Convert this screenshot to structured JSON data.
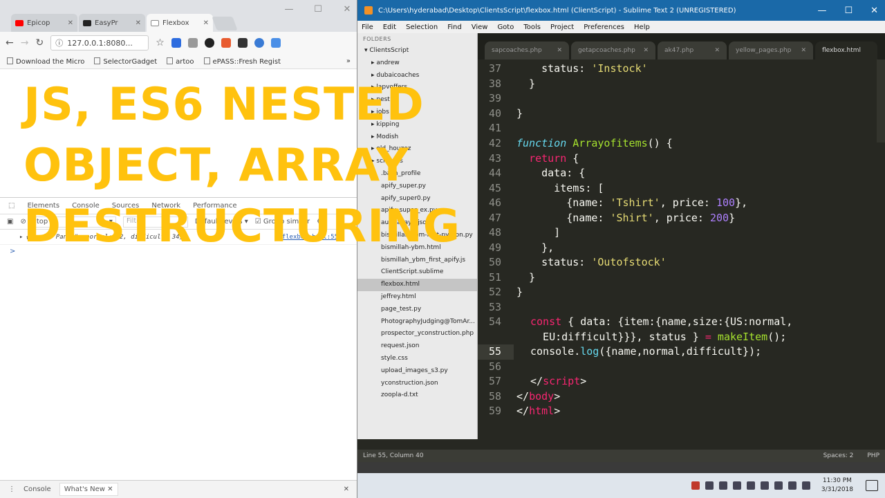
{
  "browser": {
    "tabs": [
      {
        "label": "Epicop",
        "color": "#ff0000"
      },
      {
        "label": "EasyPr",
        "color": "#222222"
      },
      {
        "label": "Flexbox",
        "color": "#888888"
      }
    ],
    "address": "127.0.0.1:8080...",
    "bookmarks": [
      "Download the Micro",
      "SelectorGadget",
      "artoo",
      "ePASS::Fresh Regist"
    ],
    "devtools": {
      "tabs": [
        "Elements",
        "Console",
        "Sources",
        "Network",
        "Performance"
      ],
      "context": "top",
      "filter_placeholder": "Filter",
      "levels": "Default levels",
      "group_similar": "Group similar",
      "log_text": "{name: \"Pants\", normal: 32, difficult: 34}",
      "log_source": "flexbox.html:55",
      "prompt": ">",
      "drawer_tabs": [
        "Console",
        "What's New"
      ]
    }
  },
  "sublime": {
    "title": "C:\\Users\\hyderabad\\Desktop\\ClientsScript\\flexbox.html (ClientScript) - Sublime Text 2 (UNREGISTERED)",
    "menu": [
      "File",
      "Edit",
      "Selection",
      "Find",
      "View",
      "Goto",
      "Tools",
      "Project",
      "Preferences",
      "Help"
    ],
    "sidebar_header": "FOLDERS",
    "files": [
      "▾ ClientsScript",
      "▸ andrew",
      "▸ dubaicoaches",
      "▸ lapvoffers",
      "▸ nest",
      "▸ jobs",
      "▸ kipping",
      "▸ Modish",
      "▸ old_houzez",
      "▸ scrapers",
      ".bash_profile",
      "apify_super.py",
      "apify_super0.py",
      "apify_super_ex.py",
      "australiayp.json",
      "bismillah-ybm-first-python.py",
      "bismillah-ybm.html",
      "bismillah_ybm_first_apify.js",
      "ClientScript.sublime",
      "flexbox.html",
      "jeffrey.html",
      "page_test.py",
      "PhotographyJudging@TomAr...",
      "prospector_yconstruction.php",
      "request.json",
      "style.css",
      "upload_images_s3.py",
      "yconstruction.json",
      "zoopla-d.txt"
    ],
    "tabs": [
      "sapcoaches.php",
      "getapcoaches.php",
      "ak47.php",
      "yellow_pages.php",
      "flexbox.html"
    ],
    "status": "Line 55, Column 40",
    "spaces": "Spaces: 2",
    "syntax": "PHP"
  },
  "code": {
    "lines": [
      "37",
      "38",
      "39",
      "40",
      "41",
      "42",
      "43",
      "44",
      "45",
      "46",
      "47",
      "48",
      "49",
      "50",
      "51",
      "52",
      "53",
      "54",
      "",
      "55",
      "56",
      "57",
      "58",
      "59"
    ],
    "l37a": "    status: ",
    "l37b": "'Instock'",
    "l38": "  }",
    "l40": "}",
    "l42_kw": "function",
    "l42_fn": "Arrayofitems",
    "l42_rest": "() {",
    "l43_kw": "return",
    "l43_rest": " {",
    "l44": "    data: {",
    "l45": "      items: [",
    "l46a": "        {name: ",
    "l46b": "'Tshirt'",
    "l46c": ", price: ",
    "l46d": "100",
    "l46e": "},",
    "l47a": "        {name: ",
    "l47b": "'Shirt'",
    "l47c": ", price: ",
    "l47d": "200",
    "l47e": "}",
    "l48": "      ]",
    "l49": "    },",
    "l50a": "    status: ",
    "l50b": "'Outofstock'",
    "l51": "  }",
    "l52": "}",
    "l54_kw": "const",
    "l54a": " { data: {item:{name,size:{US:normal,",
    "l54b": "  EU:difficult}}}, status } ",
    "l54_eq": "=",
    "l54_fn": " makeItem",
    "l54c": "();",
    "l55a": "console.",
    "l55_fn": "log",
    "l55b": "({name,normal,difficult});",
    "l57a": "</",
    "l57b": "script",
    "l57c": ">",
    "l58a": "</",
    "l58b": "body",
    "l58c": ">",
    "l59a": "</",
    "l59b": "html",
    "l59c": ">"
  },
  "taskbar": {
    "time": "11:30 PM",
    "date": "3/31/2018"
  },
  "overlay": {
    "line1": "JS, ES6 NESTED",
    "line2": "OBJECT, ARRAY",
    "line3": "DESTRUCTURING",
    "color": "#ffc20e"
  }
}
